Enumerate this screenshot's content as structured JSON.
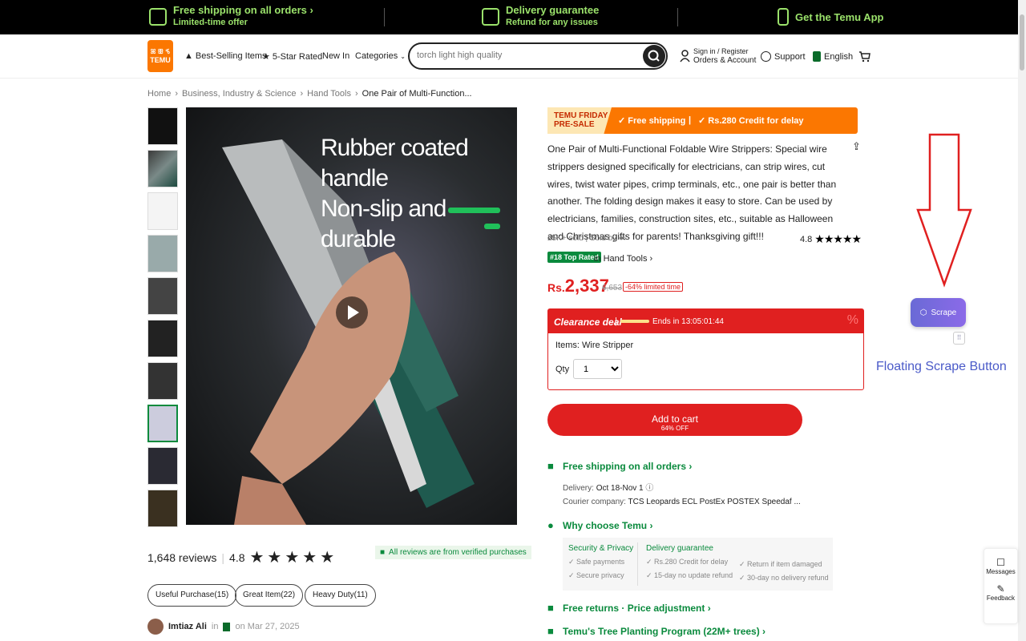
{
  "topbar": {
    "shipping_title": "Free shipping on all orders",
    "shipping_sub": "Limited-time offer",
    "delivery_title": "Delivery guarantee",
    "delivery_sub": "Refund for any issues",
    "app": "Get the Temu App"
  },
  "header": {
    "logo_top": "ꕤ ꕥ ꕦ",
    "logo_text": "TEMU",
    "nav": [
      "Best-Selling Items",
      "5-Star Rated",
      "New In",
      "Categories"
    ],
    "search_placeholder": "torch light high quality",
    "sign_in": "Sign in / Register",
    "orders": "Orders & Account",
    "support": "Support",
    "language": "English"
  },
  "breadcrumb": [
    "Home",
    "Business, Industry & Science",
    "Hand Tools",
    "One Pair of Multi-Function..."
  ],
  "media": {
    "image_text_1": "Rubber coated handle",
    "image_text_2": "Non-slip and durable",
    "thumb_count": 10,
    "selected_thumb": 7
  },
  "product": {
    "banner_promo": "TEMU FRIDAY PRE-SALE",
    "banner_free": "✓ Free shipping",
    "banner_credit": "✓ Rs.280 Credit for delay",
    "title": "One Pair of Multi-Functional Foldable Wire Strippers: Special wire strippers designed specifically for electricians, can strip wires, cut wires, twist water pipes, crimp terminals, etc., one pair is better than another. The folding design makes it easy to store. Can be used by electricians, families, construction sites, etc., suitable as Halloween and Christmas gifts for parents! Thanksgiving gift!!!",
    "sold": "25K+ sold | Sold by",
    "rating": "4.8",
    "rank_badge": "#18 Top Rated",
    "rank_cat": "in Hand Tools ›",
    "currency": "Rs.",
    "price": "2,337",
    "old_price": "6,653",
    "discount": "-64% limited time"
  },
  "deal": {
    "title": "Clearance deal",
    "ends": "Ends in  13:05:01:44",
    "items": "Items: Wire Stripper",
    "qty_label": "Qty",
    "qty_value": "1"
  },
  "cart": {
    "label": "Add to cart",
    "sub": "64% OFF"
  },
  "shipping": {
    "title": "Free shipping on all orders ›",
    "delivery_label": "Delivery:",
    "delivery_date": "Oct 18-Nov 1",
    "courier_label": "Courier company:",
    "couriers": "TCS  Leopards  ECL  PostEx  POSTEX  Speedaf ..."
  },
  "why": {
    "title": "Why choose Temu ›",
    "security": "Security & Privacy",
    "safe": "✓ Safe payments",
    "secure": "✓ Secure privacy",
    "guarantee": "Delivery guarantee",
    "credit": "✓ Rs.280 Credit for delay",
    "no_update": "✓ 15-day no update refund",
    "return": "✓ Return if item damaged",
    "no_delivery": "✓ 30-day no delivery refund"
  },
  "extra": {
    "returns": "Free returns · Price adjustment ›",
    "tree": "Temu's Tree Planting Program (22M+ trees) ›"
  },
  "reviews": {
    "count": "1,648 reviews",
    "rating": "4.8",
    "verified": "All reviews are from verified purchases",
    "tags": [
      "Useful Purchase(15)",
      "Great Item(22)",
      "Heavy Duty(11)"
    ],
    "reviewer": "Imtiaz Ali",
    "reviewer_in": "in",
    "date": "on Mar 27, 2025"
  },
  "overlay": {
    "scrape": "Scrape",
    "annotation": "Floating Scrape Button",
    "messages": "Messages",
    "feedback": "Feedback"
  },
  "colors": {
    "brand": "#fb7701",
    "red": "#e02020",
    "green": "#0a8a3d",
    "annotation": "#e02020"
  }
}
